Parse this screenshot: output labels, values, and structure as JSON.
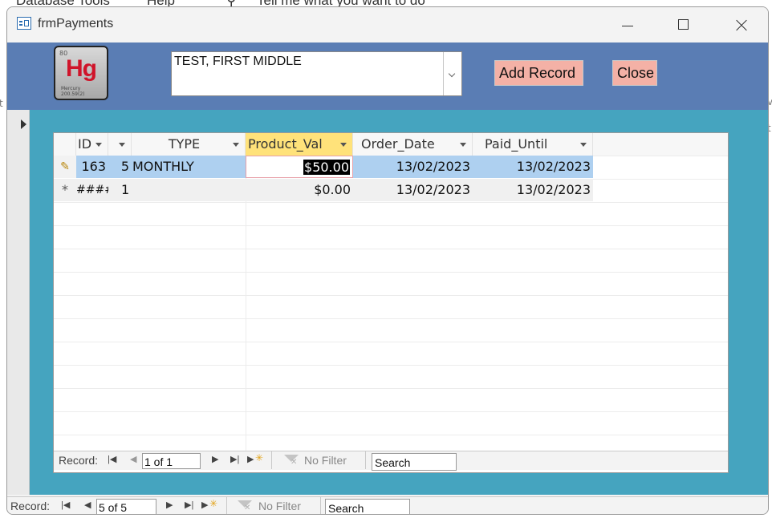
{
  "background": {
    "ribbon": [
      "Database Tools",
      "Help",
      "Tell me what you want to do"
    ],
    "left_fragment": "t",
    "right_fragments": [
      "v",
      "t"
    ]
  },
  "window": {
    "title": "frmPayments"
  },
  "header": {
    "logo": {
      "number": "80",
      "symbol": "Hg",
      "name": "Mercury",
      "mass": "200.59(2)"
    },
    "customer_combo": {
      "value": "TEST, FIRST MIDDLE"
    },
    "add_record_label": "Add Record",
    "close_label": "Close"
  },
  "subform": {
    "columns": [
      {
        "label": "ID"
      },
      {
        "label": ""
      },
      {
        "label": "TYPE"
      },
      {
        "label": "Product_Val"
      },
      {
        "label": "Order_Date"
      },
      {
        "label": "Paid_Until"
      }
    ],
    "rows": [
      {
        "selector": "edit",
        "id": "163",
        "col2": "5",
        "type": "MONTHLY",
        "product_val": "$50.00",
        "order_date": "13/02/2023",
        "paid_until": "13/02/2023"
      },
      {
        "selector": "*",
        "id": "####",
        "col2": "1",
        "type": "",
        "product_val": "$0.00",
        "order_date": "13/02/2023",
        "paid_until": "13/02/2023"
      }
    ],
    "navigation": {
      "label": "Record:",
      "position": "1 of 1",
      "filter_label": "No Filter",
      "search_label": "Search"
    }
  },
  "form_navigation": {
    "label": "Record:",
    "position": "5 of 5",
    "filter_label": "No Filter",
    "search_label": "Search"
  },
  "colors": {
    "header_bg": "#5a7db4",
    "detail_bg": "#45a4bf",
    "button_bg": "#f4b1a6",
    "selected_row": "#aed0f0",
    "active_column_header": "#ffe27a"
  }
}
